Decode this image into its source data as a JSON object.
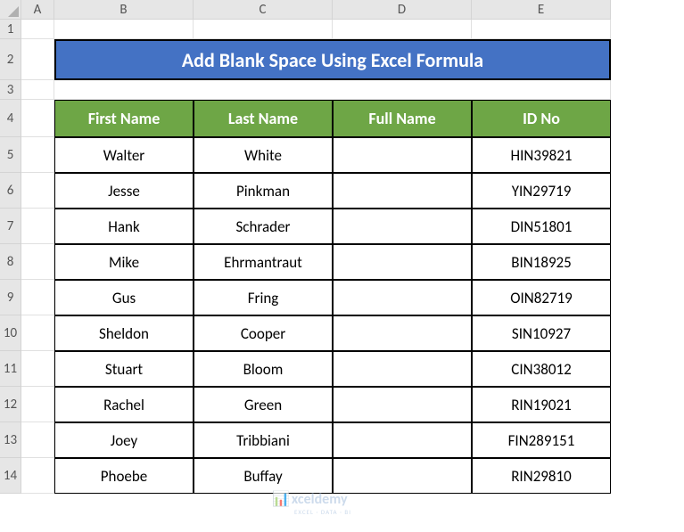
{
  "columns": [
    "",
    "A",
    "B",
    "C",
    "D",
    "E"
  ],
  "rows": [
    "1",
    "2",
    "3",
    "4",
    "5",
    "6",
    "7",
    "8",
    "9",
    "10",
    "11",
    "12",
    "13",
    "14"
  ],
  "title": "Add Blank Space Using Excel Formula",
  "headers": [
    "First Name",
    "Last Name",
    "Full Name",
    "ID No"
  ],
  "data": [
    {
      "first": "Walter",
      "last": "White",
      "full": "",
      "id": "HIN39821"
    },
    {
      "first": "Jesse",
      "last": "Pinkman",
      "full": "",
      "id": "YIN29719"
    },
    {
      "first": "Hank",
      "last": "Schrader",
      "full": "",
      "id": "DIN51801"
    },
    {
      "first": "Mike",
      "last": "Ehrmantraut",
      "full": "",
      "id": "BIN18925"
    },
    {
      "first": "Gus",
      "last": "Fring",
      "full": "",
      "id": "OIN82719"
    },
    {
      "first": "Sheldon",
      "last": "Cooper",
      "full": "",
      "id": "SIN10927"
    },
    {
      "first": "Stuart",
      "last": "Bloom",
      "full": "",
      "id": "CIN38012"
    },
    {
      "first": "Rachel",
      "last": "Green",
      "full": "",
      "id": "RIN19021"
    },
    {
      "first": "Joey",
      "last": "Tribbiani",
      "full": "",
      "id": "FIN289151"
    },
    {
      "first": "Phoebe",
      "last": "Buffay",
      "full": "",
      "id": "RIN29810"
    }
  ],
  "watermark": "xceldemy",
  "watermark_sub": "EXCEL · DATA · BI"
}
